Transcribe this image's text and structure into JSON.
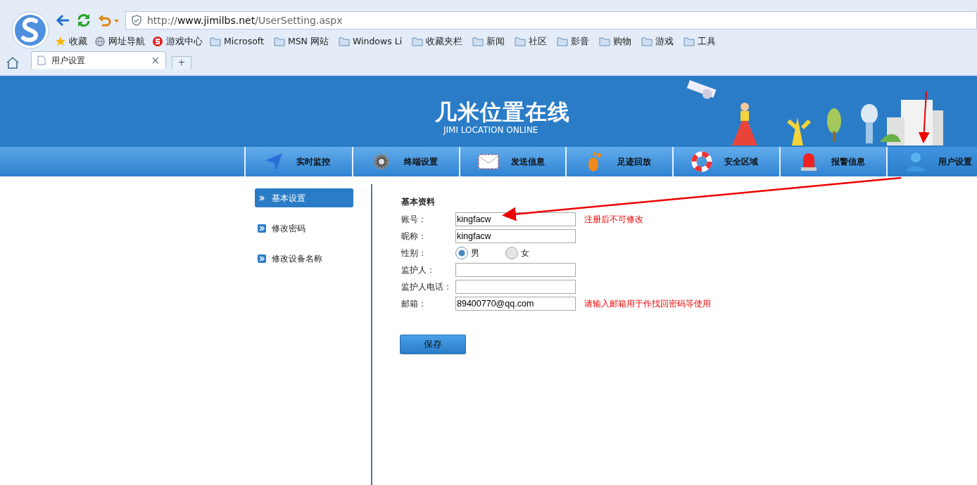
{
  "browser": {
    "url_prefix": "http://",
    "url_host": "www.jimilbs.net",
    "url_path": "/UserSetting.aspx",
    "bookmarks": [
      {
        "label": "收藏",
        "kind": "star"
      },
      {
        "label": "网址导航",
        "kind": "globe"
      },
      {
        "label": "游戏中心",
        "kind": "game"
      },
      {
        "label": "Microsoft",
        "kind": "folder"
      },
      {
        "label": "MSN 网站",
        "kind": "folder"
      },
      {
        "label": "Windows Li",
        "kind": "folder"
      },
      {
        "label": "收藏夹栏",
        "kind": "folder"
      },
      {
        "label": "新闻",
        "kind": "folder"
      },
      {
        "label": "社区",
        "kind": "folder"
      },
      {
        "label": "影音",
        "kind": "folder"
      },
      {
        "label": "购物",
        "kind": "folder"
      },
      {
        "label": "游戏",
        "kind": "folder"
      },
      {
        "label": "工具",
        "kind": "folder"
      }
    ],
    "tabs": [
      {
        "label": "用户设置",
        "selected": true
      }
    ],
    "new_tab": "+",
    "close_tab": "×"
  },
  "site": {
    "logo_title": "几米位置在线",
    "logo_subtitle": "JIMI LOCATION ONLINE",
    "nav": [
      {
        "label": "实时监控",
        "selected": false
      },
      {
        "label": "终端设置",
        "selected": false
      },
      {
        "label": "发送信息",
        "selected": false
      },
      {
        "label": "足迹回放",
        "selected": false
      },
      {
        "label": "安全区域",
        "selected": false
      },
      {
        "label": "报警信息",
        "selected": false
      },
      {
        "label": "用户设置",
        "selected": true
      }
    ]
  },
  "sidebar": [
    {
      "label": "基本设置",
      "selected": true
    },
    {
      "label": "修改密码",
      "selected": false
    },
    {
      "label": "修改设备名称",
      "selected": false
    }
  ],
  "form": {
    "heading": "基本资料",
    "fields": [
      {
        "kind": "text",
        "label": "账号：",
        "value": "kingfacw",
        "hint": "注册后不可修改"
      },
      {
        "kind": "text",
        "label": "昵称：",
        "value": "kingfacw"
      },
      {
        "kind": "radio",
        "label": "性别：",
        "options": [
          {
            "label": "男",
            "selected": true
          },
          {
            "label": "女",
            "selected": false
          }
        ]
      },
      {
        "kind": "text",
        "label": "监护人："
      },
      {
        "kind": "text",
        "label": "监护人电话："
      },
      {
        "kind": "text",
        "label": "邮箱：",
        "value": "89400770@qq.com",
        "hint": "请输入邮箱用于作找回密码等使用"
      }
    ],
    "save_button": "保存"
  }
}
